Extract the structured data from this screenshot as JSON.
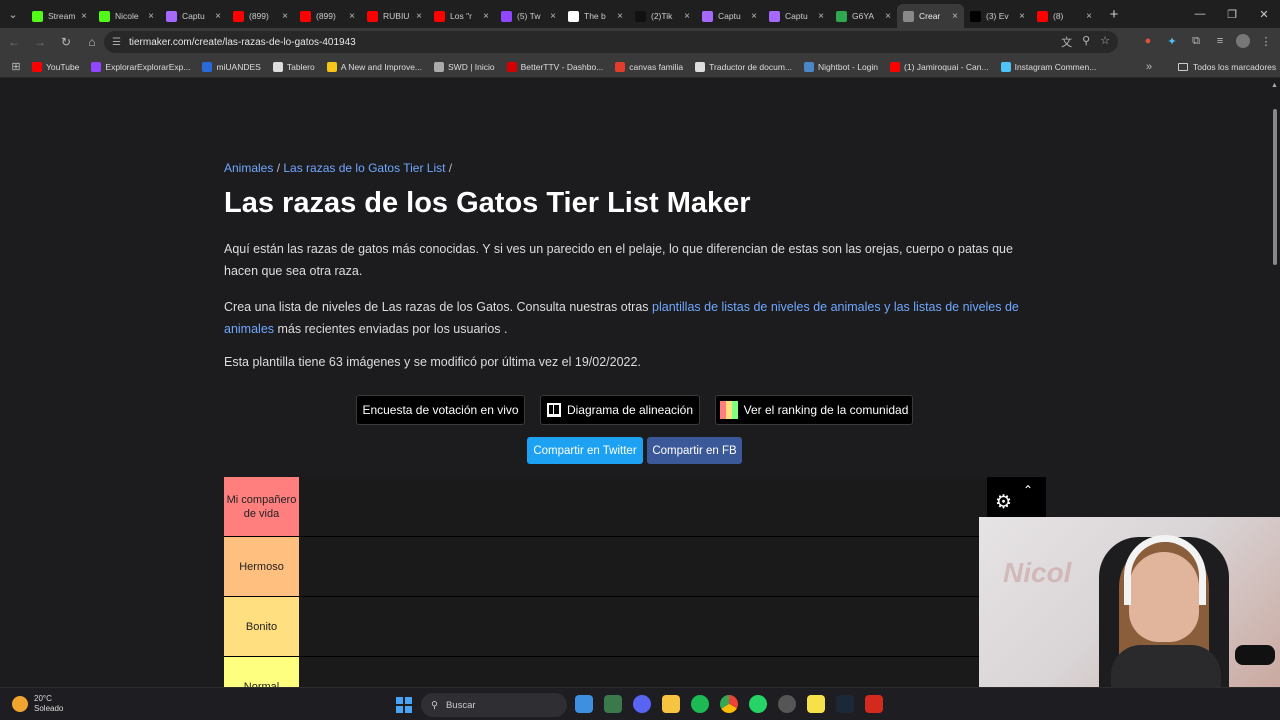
{
  "browser": {
    "tabs": [
      {
        "title": "Stream",
        "color": "#53fc18"
      },
      {
        "title": "Nicole",
        "color": "#53fc18"
      },
      {
        "title": "Captu",
        "color": "#a569ff"
      },
      {
        "title": "(899)",
        "color": "#ff0000"
      },
      {
        "title": "(899)",
        "color": "#ff0000"
      },
      {
        "title": "RUBIU",
        "color": "#ff0000"
      },
      {
        "title": "Los \"r",
        "color": "#ff0000"
      },
      {
        "title": "(5) Tw",
        "color": "#9146ff"
      },
      {
        "title": "The b",
        "color": "#ffffff"
      },
      {
        "title": "(2)Tik",
        "color": "#111111"
      },
      {
        "title": "Captu",
        "color": "#a569ff"
      },
      {
        "title": "Captu",
        "color": "#a569ff"
      },
      {
        "title": "G6YA",
        "color": "#2fa84f"
      },
      {
        "title": "Crear",
        "color": "#888888",
        "active": true
      },
      {
        "title": "(3) Ev",
        "color": "#000000"
      },
      {
        "title": "(8)",
        "color": "#ff0000"
      }
    ],
    "url": "tiermaker.com/create/las-razas-de-lo-gatos-401943",
    "bookmarks": [
      {
        "label": "YouTube",
        "color": "#ff0000"
      },
      {
        "label": "ExplorarExplorarExp...",
        "color": "#9146ff"
      },
      {
        "label": "miUANDES",
        "color": "#2a6ad8"
      },
      {
        "label": "Tablero",
        "color": "#dddddd"
      },
      {
        "label": "A New and Improve...",
        "color": "#f5c518"
      },
      {
        "label": "SWD | Inicio",
        "color": "#aaaaaa"
      },
      {
        "label": "BetterTTV - Dashbo...",
        "color": "#d50000"
      },
      {
        "label": "canvas familia",
        "color": "#e13c2c"
      },
      {
        "label": "Traductor de docum...",
        "color": "#dddddd"
      },
      {
        "label": "Nightbot - Login",
        "color": "#4b86c8"
      },
      {
        "label": "(1) Jamiroquai - Can...",
        "color": "#ff0000"
      },
      {
        "label": "Instagram Commen...",
        "color": "#4fc3f7"
      }
    ],
    "all_bookmarks": "Todos los marcadores"
  },
  "page": {
    "breadcrumb_1": "Animales",
    "breadcrumb_2": "Las razas de lo Gatos Tier List",
    "title": "Las razas de los Gatos Tier List Maker",
    "description": "Aquí están las razas de gatos más conocidas. Y si ves un parecido en el pelaje, lo que diferencian de estas son las orejas, cuerpo o patas que hacen que sea otra raza.",
    "p2_before": "Crea una lista de niveles de Las razas de los Gatos. Consulta nuestras otras ",
    "p2_link": "plantillas de listas de niveles de animales y las listas de niveles de animales",
    "p2_after": " más recientes enviadas por los usuarios .",
    "info": "Esta plantilla tiene 63 imágenes y se modificó por última vez el 19/02/2022.",
    "btn_live_vote": "Encuesta de votación en vivo",
    "btn_alignment": "Diagrama de alineación",
    "btn_ranking": "Ver el ranking de la comunidad",
    "btn_twitter": "Compartir en Twitter",
    "btn_fb": "Compartir en FB",
    "twitter_color": "#1da1f2",
    "fb_color": "#3b5998"
  },
  "tiers": [
    {
      "label": "Mi compañero de vida",
      "color": "#ff7f7f"
    },
    {
      "label": "Hermoso",
      "color": "#ffbf7f"
    },
    {
      "label": "Bonito",
      "color": "#ffdf7f"
    },
    {
      "label": "Normal",
      "color": "#ffff7f"
    }
  ],
  "taskbar": {
    "temp": "20°C",
    "weather": "Soleado",
    "search": "Buscar"
  }
}
